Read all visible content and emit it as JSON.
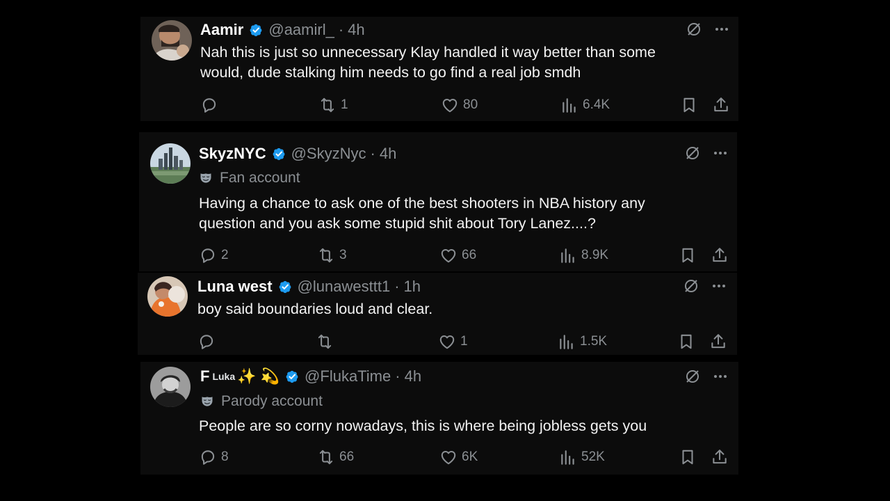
{
  "tweets": [
    {
      "name": "Aamir",
      "handle": "@aamirl_",
      "time": "4h",
      "label": "",
      "text": "Nah this is just so unnecessary Klay handled it way better than some would, dude stalking him needs to go find a real job smdh",
      "replies": "",
      "retweets": "1",
      "likes": "80",
      "views": "6.4K"
    },
    {
      "name": "SkyzNYC",
      "handle": "@SkyzNyc",
      "time": "4h",
      "label": "Fan account",
      "text": "Having a chance to ask one of the best shooters in NBA history any question and you ask some stupid shit about Tory Lanez....?",
      "replies": "2",
      "retweets": "3",
      "likes": "66",
      "views": "8.9K"
    },
    {
      "name": "Luna west",
      "handle": "@lunawesttt1",
      "time": "1h",
      "label": "",
      "text": "boy said boundaries loud and clear.",
      "replies": "",
      "retweets": "",
      "likes": "1",
      "views": "1.5K"
    },
    {
      "name": "F",
      "name_sup": "Luka",
      "name_emoji": "✨ 💫",
      "handle": "@FlukaTime",
      "time": "4h",
      "label": "Parody account",
      "text": "People are so corny nowadays, this is where being jobless gets you",
      "replies": "8",
      "retweets": "66",
      "likes": "6K",
      "views": "52K"
    }
  ],
  "separator": "·",
  "colors": {
    "background": "#000000",
    "card": "#0c0c0c",
    "verified": "#1d9bf0",
    "muted": "#8b8f93",
    "text": "#e7e9ea"
  },
  "icons": {
    "verified": "verified-badge-icon",
    "grok": "grok-icon",
    "more": "more-icon",
    "reply": "reply-icon",
    "retweet": "retweet-icon",
    "like": "like-icon",
    "views": "views-icon",
    "bookmark": "bookmark-icon",
    "share": "share-icon",
    "mask": "mask-icon"
  }
}
